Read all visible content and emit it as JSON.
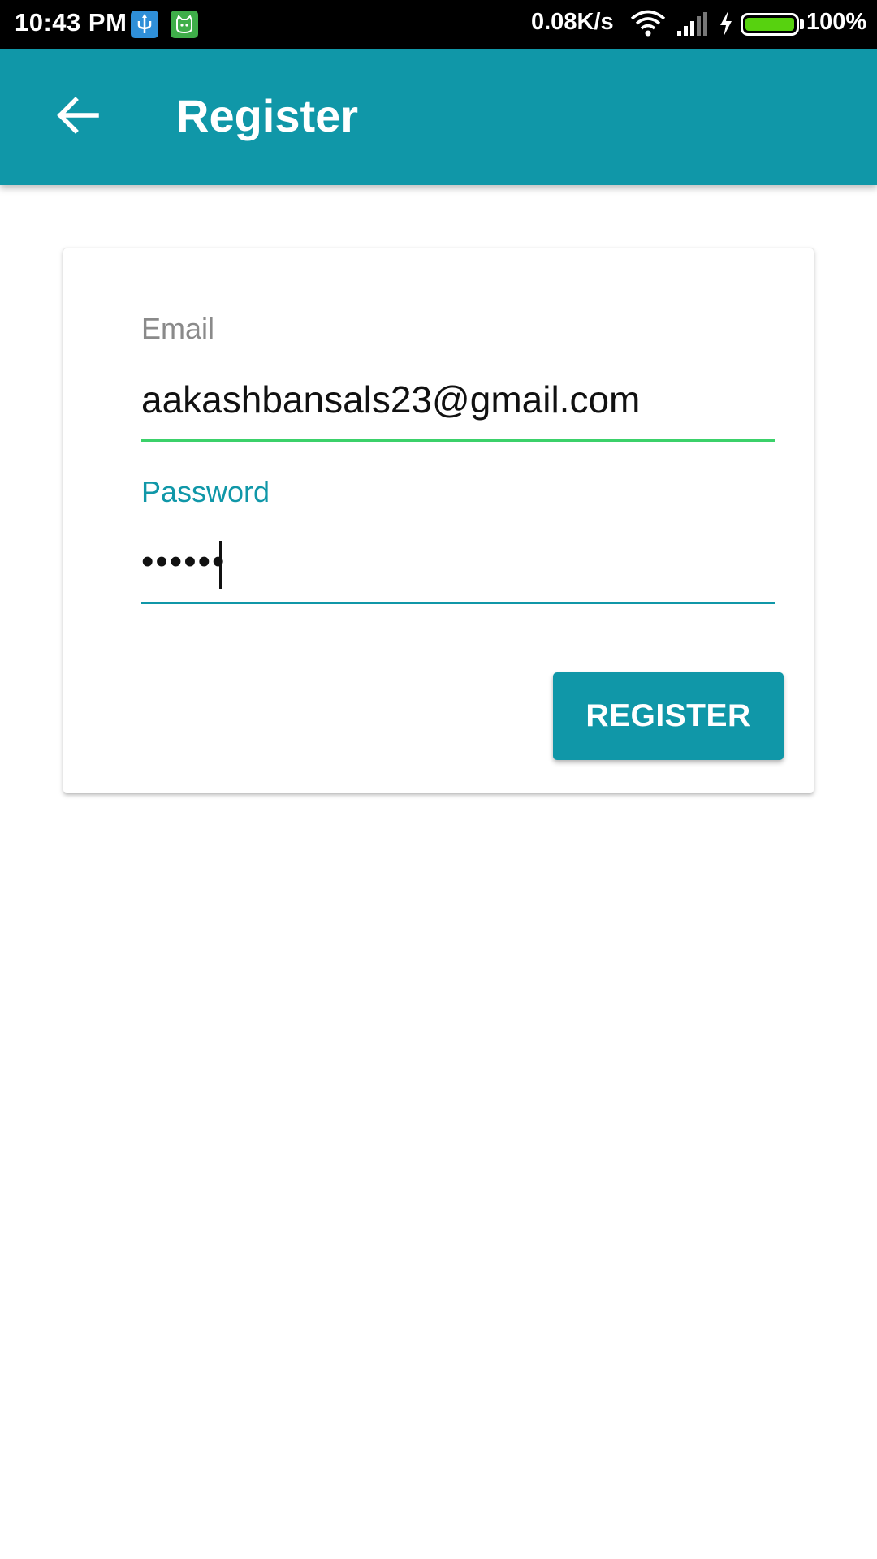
{
  "status_bar": {
    "time": "10:43 PM",
    "notification_icons": [
      "usb-icon",
      "cat-app-icon"
    ],
    "network_speed": "0.08K/s",
    "status_icons": [
      "wifi-icon",
      "signal-icon",
      "charging-bolt-icon",
      "battery-icon"
    ],
    "battery_percent": "100%",
    "battery_level": 1.0
  },
  "app_bar": {
    "back_icon": "arrow-left-icon",
    "title": "Register",
    "color": "#1097a8"
  },
  "form": {
    "email": {
      "label": "Email",
      "value": "aakashbansals23@gmail.com",
      "underline_color": "#3bd16a"
    },
    "password": {
      "label": "Password",
      "value": "••••••",
      "focused": true,
      "accent_color": "#1097a8"
    },
    "submit_label": "REGISTER"
  }
}
